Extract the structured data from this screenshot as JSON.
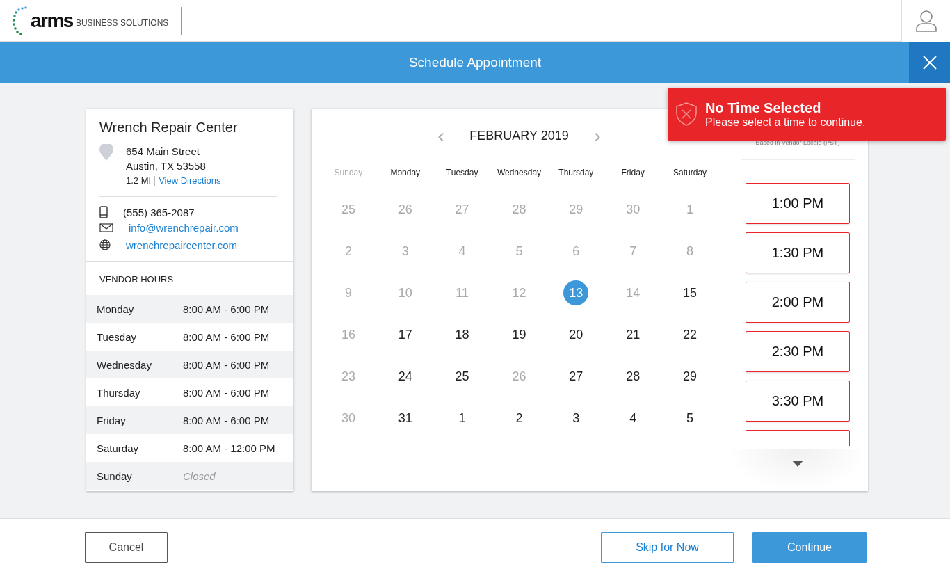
{
  "header": {
    "logo_word": "arms",
    "logo_tagline": "BUSINESS SOLUTIONS"
  },
  "title_bar": {
    "title": "Schedule Appointment"
  },
  "vendor": {
    "name": "Wrench Repair Center",
    "address_lines": [
      "654 Main Street",
      "Austin, TX 53558"
    ],
    "distance": "1.2 MI",
    "directions_link": "View Directions",
    "phone": "(555) 365-2087",
    "email": "info@wrenchrepair.com",
    "website": "wrenchrepaircenter.com",
    "hours_heading": "VENDOR HOURS",
    "hours": [
      {
        "day": "Monday",
        "hours": "8:00 AM - 6:00 PM",
        "closed": false
      },
      {
        "day": "Tuesday",
        "hours": "8:00 AM - 6:00 PM",
        "closed": false
      },
      {
        "day": "Wednesday",
        "hours": "8:00 AM - 6:00 PM",
        "closed": false
      },
      {
        "day": "Thursday",
        "hours": "8:00 AM - 6:00 PM",
        "closed": false
      },
      {
        "day": "Friday",
        "hours": "8:00 AM - 6:00 PM",
        "closed": false
      },
      {
        "day": "Saturday",
        "hours": "8:00 AM - 12:00 PM",
        "closed": false
      },
      {
        "day": "Sunday",
        "hours": "Closed",
        "closed": true
      }
    ]
  },
  "calendar": {
    "prev": "‹",
    "month": "FEBRUARY 2019",
    "next": "›",
    "weekdays": [
      {
        "label": "Sunday",
        "disabled": true
      },
      {
        "label": "Monday",
        "disabled": false
      },
      {
        "label": "Tuesday",
        "disabled": false
      },
      {
        "label": "Wednesday",
        "disabled": false
      },
      {
        "label": "Thursday",
        "disabled": false
      },
      {
        "label": "Friday",
        "disabled": false
      },
      {
        "label": "Saturday",
        "disabled": false
      }
    ],
    "weeks": [
      [
        {
          "d": "25",
          "disabled": true,
          "selected": false
        },
        {
          "d": "26",
          "disabled": true,
          "selected": false
        },
        {
          "d": "27",
          "disabled": true,
          "selected": false
        },
        {
          "d": "28",
          "disabled": true,
          "selected": false
        },
        {
          "d": "29",
          "disabled": true,
          "selected": false
        },
        {
          "d": "30",
          "disabled": true,
          "selected": false
        },
        {
          "d": "1",
          "disabled": true,
          "selected": false
        }
      ],
      [
        {
          "d": "2",
          "disabled": true,
          "selected": false
        },
        {
          "d": "3",
          "disabled": true,
          "selected": false
        },
        {
          "d": "4",
          "disabled": true,
          "selected": false
        },
        {
          "d": "5",
          "disabled": true,
          "selected": false
        },
        {
          "d": "6",
          "disabled": true,
          "selected": false
        },
        {
          "d": "7",
          "disabled": true,
          "selected": false
        },
        {
          "d": "8",
          "disabled": true,
          "selected": false
        }
      ],
      [
        {
          "d": "9",
          "disabled": true,
          "selected": false
        },
        {
          "d": "10",
          "disabled": true,
          "selected": false
        },
        {
          "d": "11",
          "disabled": true,
          "selected": false
        },
        {
          "d": "12",
          "disabled": true,
          "selected": false
        },
        {
          "d": "13",
          "disabled": false,
          "selected": true
        },
        {
          "d": "14",
          "disabled": true,
          "selected": false
        },
        {
          "d": "15",
          "disabled": false,
          "selected": false
        }
      ],
      [
        {
          "d": "16",
          "disabled": true,
          "selected": false
        },
        {
          "d": "17",
          "disabled": false,
          "selected": false
        },
        {
          "d": "18",
          "disabled": false,
          "selected": false
        },
        {
          "d": "19",
          "disabled": false,
          "selected": false
        },
        {
          "d": "20",
          "disabled": false,
          "selected": false
        },
        {
          "d": "21",
          "disabled": false,
          "selected": false
        },
        {
          "d": "22",
          "disabled": false,
          "selected": false
        }
      ],
      [
        {
          "d": "23",
          "disabled": true,
          "selected": false
        },
        {
          "d": "24",
          "disabled": false,
          "selected": false
        },
        {
          "d": "25",
          "disabled": false,
          "selected": false
        },
        {
          "d": "26",
          "disabled": true,
          "selected": false
        },
        {
          "d": "27",
          "disabled": false,
          "selected": false
        },
        {
          "d": "28",
          "disabled": false,
          "selected": false
        },
        {
          "d": "29",
          "disabled": false,
          "selected": false
        }
      ],
      [
        {
          "d": "30",
          "disabled": true,
          "selected": false
        },
        {
          "d": "31",
          "disabled": false,
          "selected": false
        },
        {
          "d": "1",
          "disabled": false,
          "selected": false
        },
        {
          "d": "2",
          "disabled": false,
          "selected": false
        },
        {
          "d": "3",
          "disabled": false,
          "selected": false
        },
        {
          "d": "4",
          "disabled": false,
          "selected": false
        },
        {
          "d": "5",
          "disabled": false,
          "selected": false
        }
      ]
    ]
  },
  "appointments": {
    "subtitle": "Based in Vendor Locale (PST)",
    "slots": [
      {
        "time": "1:00 PM",
        "selected": false
      },
      {
        "time": "1:30 PM",
        "selected": false
      },
      {
        "time": "2:00 PM",
        "selected": false
      },
      {
        "time": "2:30 PM",
        "selected": false
      },
      {
        "time": "3:30 PM",
        "selected": false
      }
    ],
    "more_below": true
  },
  "toast": {
    "title": "No Time Selected",
    "message": "Please select a time to continue."
  },
  "footer": {
    "cancel": "Cancel",
    "skip": "Skip for Now",
    "continue": "Continue"
  }
}
